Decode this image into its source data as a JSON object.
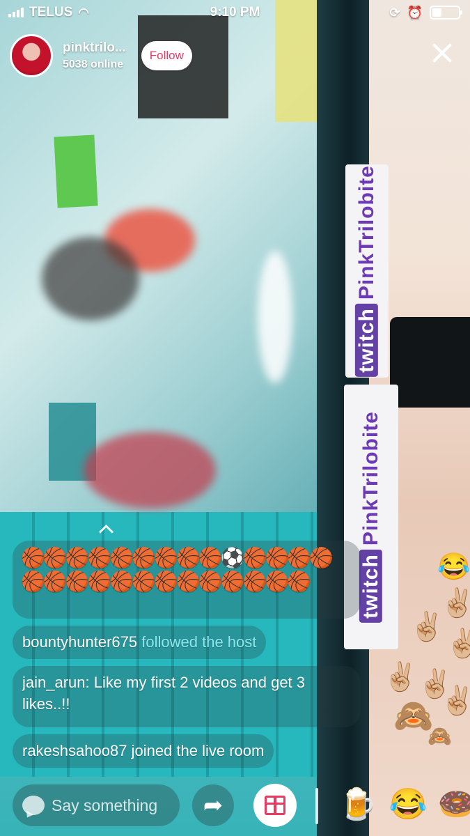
{
  "status_bar": {
    "carrier": "TELUS",
    "time": "9:10 PM",
    "battery_level": 0.35
  },
  "host": {
    "name": "pinktrilo...",
    "online": "5038 online",
    "follow_label": "Follow"
  },
  "stream_overlay": {
    "sticker_text_1": "PinkTrilobite",
    "sticker_text_2": "PinkTrilobite",
    "sticker_brand": "twitch"
  },
  "chat": {
    "emoji_message": "🏀🏀🏀🏀🏀🏀🏀🏀🏀⚽🏀🏀🏀🏀🏀🏀🏀🏀🏀🏀🏀🏀🏀🏀🏀🏀🏀",
    "messages": [
      {
        "user": "bountyhunter675",
        "text": "followed the host"
      },
      {
        "user": "jain_arun",
        "text": "Like my first 2 videos and get 3 likes..!!"
      },
      {
        "user": "rakeshsahoo87",
        "text": "joined the live room"
      }
    ]
  },
  "floating_reactions": [
    "😂",
    "✌🏼",
    "✌🏼",
    "✌🏼",
    "✌🏼",
    "✌🏼",
    "✌🏼",
    "🙈",
    "🙈"
  ],
  "bottom_bar": {
    "input_placeholder": "Say something",
    "quick_gifts": [
      "🍺",
      "😂",
      "🍩"
    ]
  },
  "icons": {
    "share": "share-arrow-icon",
    "gift": "gift-icon",
    "close": "close-icon",
    "chat": "chat-bubble-icon"
  },
  "colors": {
    "follow_text": "#e73b62",
    "followed_highlight": "#8ee6ef"
  }
}
